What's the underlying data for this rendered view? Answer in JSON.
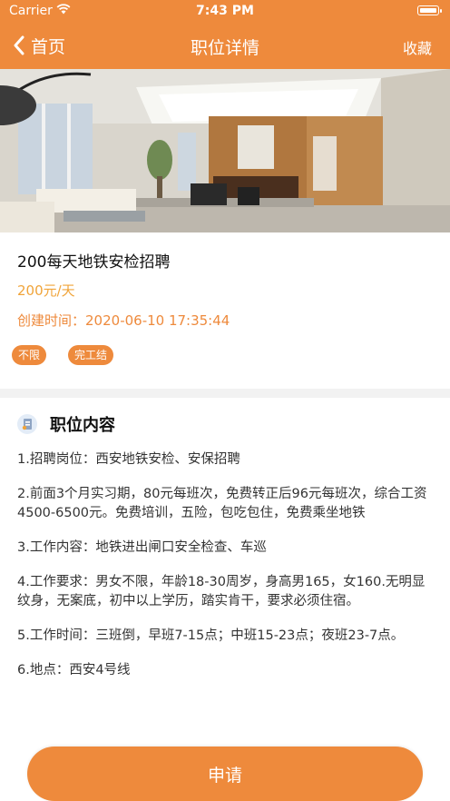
{
  "status": {
    "carrier": "Carrier",
    "time": "7:43 PM"
  },
  "nav": {
    "back_label": "首页",
    "title": "职位详情",
    "favorite_label": "收藏"
  },
  "job": {
    "title": "200每天地铁安检招聘",
    "salary": "200元/天",
    "created_label": "创建时间：",
    "created_value": "2020-06-10 17:35:44",
    "tags": [
      "不限",
      "完工结"
    ]
  },
  "content": {
    "section_title": "职位内容",
    "paragraphs": [
      "1.招聘岗位：西安地铁安检、安保招聘",
      "2.前面3个月实习期，80元每班次，免费转正后96元每班次，综合工资4500-6500元。免费培训，五险，包吃包住，免费乘坐地铁",
      "3.工作内容：地铁进出闸口安全检查、车巡",
      "4.工作要求：男女不限，年龄18-30周岁，身高男165，女160.无明显纹身，无案底，初中以上学历，踏实肯干，要求必须住宿。",
      "5.工作时间：三班倒，早班7-15点；中班15-23点；夜班23-7点。",
      "6.地点：西安4号线"
    ]
  },
  "apply_label": "申请",
  "colors": {
    "accent": "#ee8a3c",
    "salary": "#f0a43a"
  }
}
